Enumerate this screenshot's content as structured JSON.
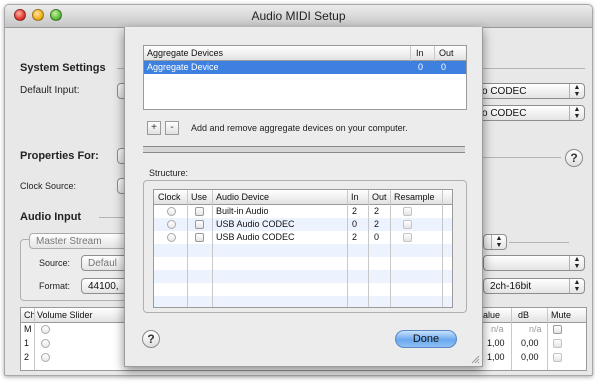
{
  "window": {
    "title": "Audio MIDI Setup"
  },
  "system_settings": {
    "label": "System Settings",
    "default_input_label": "Default Input:",
    "default_input_partial": "o CODEC",
    "default_output_partial": "o CODEC"
  },
  "properties": {
    "label": "Properties For:",
    "clock_source_label": "Clock Source:"
  },
  "audio_input": {
    "label": "Audio Input",
    "stream_popup": "Master Stream",
    "source_label": "Source:",
    "source_value": "Defaul",
    "format_label": "Format:",
    "format_value": "44100,",
    "format_right": "2ch-16bit"
  },
  "channels": {
    "headers": {
      "ch": "Ch",
      "volume": "Volume Slider",
      "value": "alue",
      "db": "dB",
      "mute": "Mute"
    },
    "rows": [
      {
        "ch": "M",
        "value": "n/a",
        "db": "n/a"
      },
      {
        "ch": "1",
        "value": "1,00",
        "db": "0,00"
      },
      {
        "ch": "2",
        "value": "1,00",
        "db": "0,00"
      }
    ]
  },
  "sheet": {
    "aggregate_table": {
      "headers": {
        "name": "Aggregate Devices",
        "in": "In",
        "out": "Out"
      },
      "rows": [
        {
          "name": "Aggregate Device",
          "in": "0",
          "out": "0"
        }
      ]
    },
    "add_symbol": "+",
    "remove_symbol": "-",
    "hint": "Add and remove aggregate devices on your computer.",
    "structure_label": "Structure:",
    "structure_table": {
      "headers": {
        "clock": "Clock",
        "use": "Use",
        "device": "Audio Device",
        "in": "In",
        "out": "Out",
        "resample": "Resample"
      },
      "rows": [
        {
          "device": "Built-in Audio",
          "in": "2",
          "out": "2"
        },
        {
          "device": "USB Audio CODEC",
          "in": "0",
          "out": "2"
        },
        {
          "device": "USB Audio CODEC",
          "in": "2",
          "out": "0"
        }
      ]
    },
    "help_symbol": "?",
    "done_label": "Done"
  },
  "help_symbol": "?"
}
